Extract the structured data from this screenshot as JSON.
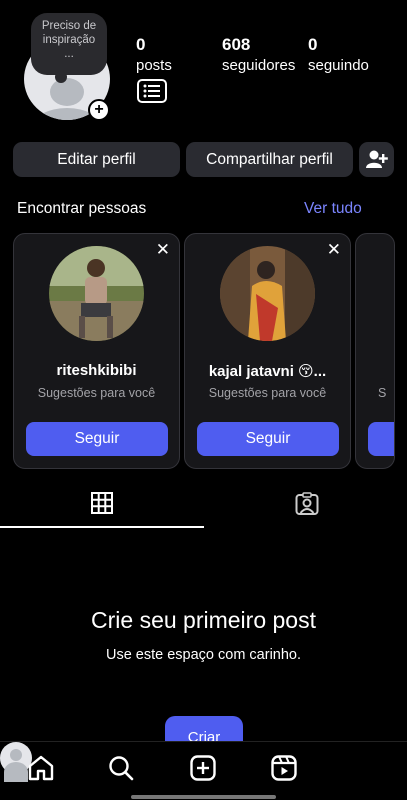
{
  "note": {
    "line1": "Preciso de",
    "line2": "inspiração",
    "dots": "..."
  },
  "stats": {
    "posts": {
      "value": "0",
      "label": "posts"
    },
    "followers": {
      "value": "608",
      "label": "seguidores"
    },
    "following": {
      "value": "0",
      "label": "seguindo"
    }
  },
  "actions": {
    "edit": "Editar perfil",
    "share": "Compartilhar perfil"
  },
  "find_people": {
    "title": "Encontrar pessoas",
    "see_all": "Ver tudo"
  },
  "suggestions": [
    {
      "name": "riteshkibibi",
      "subtitle": "Sugestões para você",
      "follow": "Seguir",
      "dismiss": "✕"
    },
    {
      "name": "kajal jatavni 😚...",
      "subtitle": "Sugestões para você",
      "follow": "Seguir",
      "dismiss": "✕"
    },
    {
      "subtitle_peek": "S",
      "follow_peek": ""
    }
  ],
  "empty_state": {
    "title": "Crie seu primeiro post",
    "subtitle": "Use este espaço com carinho.",
    "create": "Criar"
  },
  "colors": {
    "background": "#000000",
    "accent": "#4f5df0",
    "link": "#7b85ff",
    "card": "#17171a",
    "button": "#2a2b31"
  },
  "icons": {
    "menu": "list-menu-icon",
    "add_user": "add-user-icon",
    "grid": "grid-icon",
    "tagged": "tagged-person-icon",
    "home": "home-icon",
    "search": "search-icon",
    "add": "add-post-icon",
    "reels": "reels-icon",
    "profile": "profile-avatar-icon"
  }
}
